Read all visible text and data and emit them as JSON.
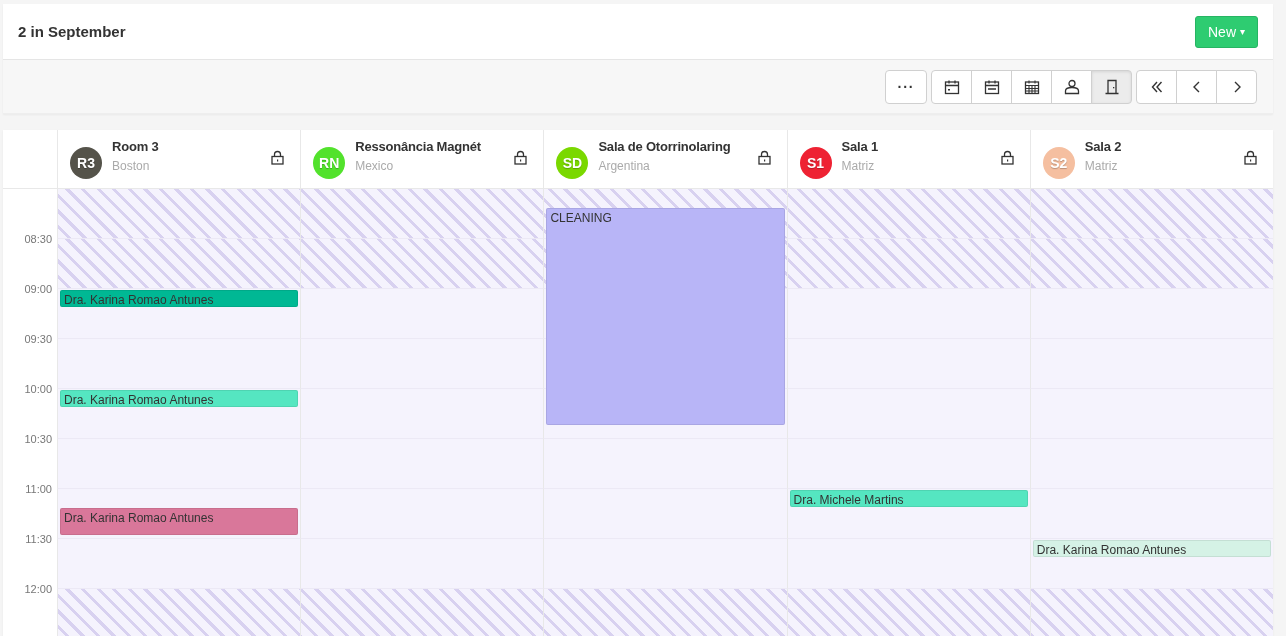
{
  "header": {
    "title": "2 in September",
    "new_button": {
      "label": "New",
      "caret": "▾"
    }
  },
  "toolbar": {
    "more_button": "···",
    "view_buttons": [
      {
        "kind": "day",
        "selected": false
      },
      {
        "kind": "week",
        "selected": false
      },
      {
        "kind": "month",
        "selected": false
      },
      {
        "kind": "professional",
        "selected": false
      },
      {
        "kind": "room",
        "selected": true
      }
    ],
    "nav_buttons": [
      {
        "kind": "first"
      },
      {
        "kind": "previous"
      },
      {
        "kind": "next"
      }
    ]
  },
  "calendar": {
    "resources": [
      {
        "initials": "R3",
        "color": "#55534a",
        "name": "Room 3",
        "location": "Boston",
        "locked": true
      },
      {
        "initials": "RN",
        "color": "#52e22c",
        "name": "Ressonância Magnét",
        "location": "Mexico",
        "locked": true
      },
      {
        "initials": "SD",
        "color": "#7ad800",
        "name": "Sala de Otorrinolaring",
        "location": "Argentina",
        "locked": true
      },
      {
        "initials": "S1",
        "color": "#ee2233",
        "name": "Sala 1",
        "location": "Matriz",
        "locked": true
      },
      {
        "initials": "S2",
        "color": "#f5bfa0",
        "name": "Sala 2",
        "location": "Matriz",
        "locked": true
      }
    ],
    "rows": [
      {
        "unavailable": true,
        "cells": [
          {
            "kind": "free"
          },
          {
            "kind": "free"
          },
          {
            "kind": "long",
            "title": "CLEANING",
            "color": "#b8b5f7"
          },
          {
            "kind": "free"
          },
          {
            "kind": "free"
          }
        ]
      },
      {
        "time": "08:30",
        "unavailable": true,
        "cells": [
          {
            "kind": "free"
          },
          {
            "kind": "free"
          },
          {
            "kind": "free"
          },
          {
            "kind": "free"
          },
          {
            "kind": "free"
          }
        ]
      },
      {
        "time": "09:00",
        "unavailable": false,
        "cells": [
          {
            "kind": "short",
            "title": "Dra. Karina Romao Antunes",
            "color": "#00b894"
          },
          {
            "kind": "free"
          },
          {
            "kind": "free"
          },
          {
            "kind": "free"
          },
          {
            "kind": "free"
          }
        ]
      },
      {
        "time": "09:30",
        "unavailable": false,
        "cells": [
          {
            "kind": "free"
          },
          {
            "kind": "free"
          },
          {
            "kind": "free"
          },
          {
            "kind": "free"
          },
          {
            "kind": "free"
          }
        ]
      },
      {
        "time": "10:00",
        "unavailable": false,
        "cells": [
          {
            "kind": "short",
            "title": "Dra. Karina Romao Antunes",
            "color": "#55e6c1"
          },
          {
            "kind": "free"
          },
          {
            "kind": "free"
          },
          {
            "kind": "free"
          },
          {
            "kind": "free"
          }
        ]
      },
      {
        "time": "10:30",
        "unavailable": false,
        "cells": [
          {
            "kind": "free"
          },
          {
            "kind": "free"
          },
          {
            "kind": "free"
          },
          {
            "kind": "free"
          },
          {
            "kind": "free"
          }
        ]
      },
      {
        "time": "11:00",
        "unavailable": false,
        "cells": [
          {
            "kind": "late",
            "title": "Dra. Karina Romao Antunes",
            "color": "#d9779a"
          },
          {
            "kind": "free"
          },
          {
            "kind": "free"
          },
          {
            "kind": "short",
            "title": "Dra. Michele Martins",
            "color": "#55e6c1"
          },
          {
            "kind": "free"
          }
        ]
      },
      {
        "time": "11:30",
        "unavailable": false,
        "cells": [
          {
            "kind": "free"
          },
          {
            "kind": "free"
          },
          {
            "kind": "free"
          },
          {
            "kind": "free"
          },
          {
            "kind": "short",
            "title": "Dra. Karina Romao Antunes",
            "color": "#d5f2e6"
          }
        ]
      },
      {
        "time": "12:00",
        "unavailable": true,
        "cells": [
          {
            "kind": "free"
          },
          {
            "kind": "free"
          },
          {
            "kind": "free"
          },
          {
            "kind": "free"
          },
          {
            "kind": "free"
          }
        ]
      }
    ]
  }
}
